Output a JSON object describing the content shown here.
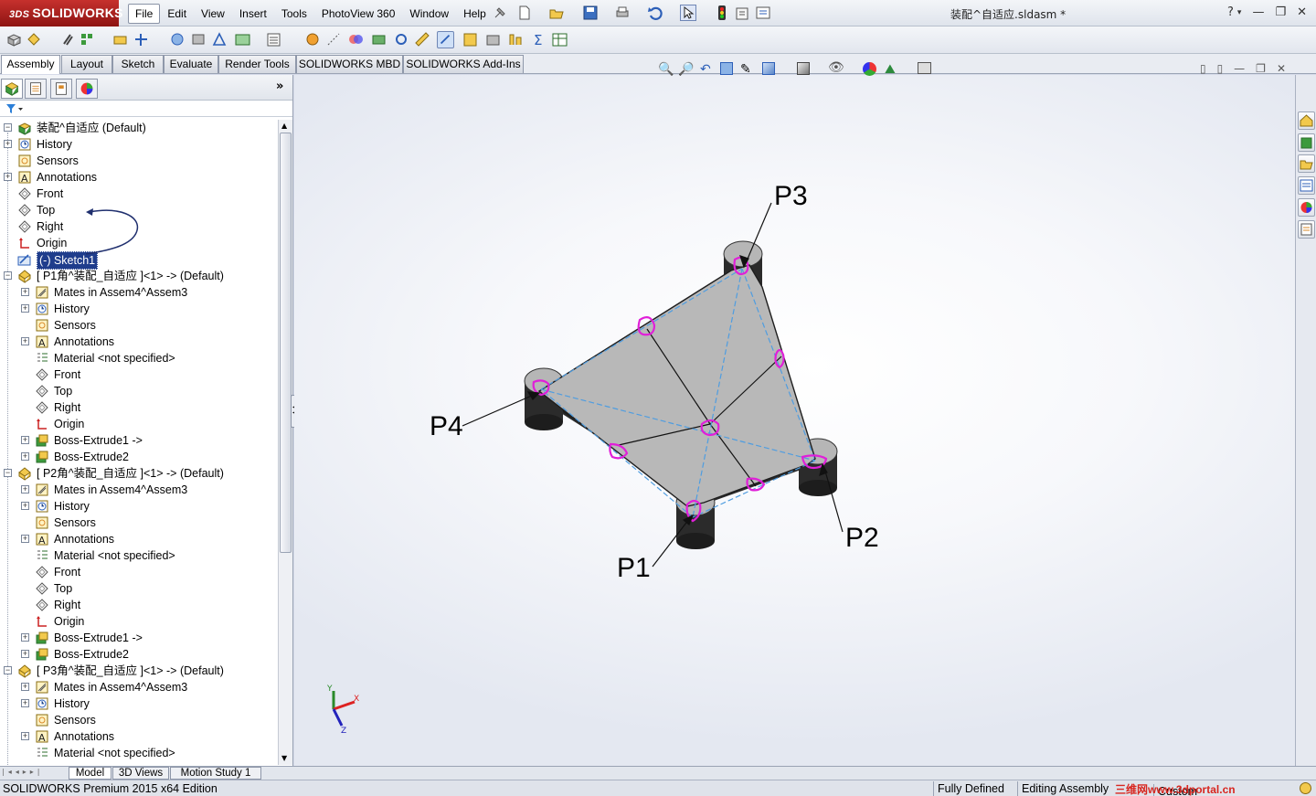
{
  "app": {
    "logo_text": "SOLIDWORKS",
    "logo_prefix": "3DS",
    "document_title": "装配^自适应.sldasm *"
  },
  "menu": [
    "File",
    "Edit",
    "View",
    "Insert",
    "Tools",
    "PhotoView 360",
    "Window",
    "Help"
  ],
  "command_tabs": [
    "Assembly",
    "Layout",
    "Sketch",
    "Evaluate",
    "Render Tools",
    "SOLIDWORKS MBD",
    "SOLIDWORKS Add-Ins"
  ],
  "active_tab": "Assembly",
  "feature_tree": [
    {
      "level": 0,
      "expander": "-",
      "icon": "assembly-icon",
      "label": "装配^自适应  (Default)"
    },
    {
      "level": 0,
      "expander": "+",
      "icon": "history-icon",
      "label": "History"
    },
    {
      "level": 0,
      "expander": "",
      "icon": "sensor-icon",
      "label": "Sensors"
    },
    {
      "level": 0,
      "expander": "+",
      "icon": "annotation-icon",
      "label": "Annotations"
    },
    {
      "level": 0,
      "expander": "",
      "icon": "plane-icon",
      "label": "Front"
    },
    {
      "level": 0,
      "expander": "",
      "icon": "plane-icon",
      "label": "Top"
    },
    {
      "level": 0,
      "expander": "",
      "icon": "plane-icon",
      "label": "Right"
    },
    {
      "level": 0,
      "expander": "",
      "icon": "origin-icon",
      "label": "Origin"
    },
    {
      "level": 0,
      "expander": "",
      "icon": "sketch-icon",
      "label": "(-) Sketch1",
      "selected": true
    },
    {
      "level": 0,
      "expander": "-",
      "icon": "part-icon",
      "label": "[ P1角^装配_自适应 ]<1> -> (Default)"
    },
    {
      "level": 1,
      "expander": "+",
      "icon": "mates-icon",
      "label": "Mates in Assem4^Assem3"
    },
    {
      "level": 1,
      "expander": "+",
      "icon": "history-icon",
      "label": "History"
    },
    {
      "level": 1,
      "expander": "",
      "icon": "sensor-icon",
      "label": "Sensors"
    },
    {
      "level": 1,
      "expander": "+",
      "icon": "annotation-icon",
      "label": "Annotations"
    },
    {
      "level": 1,
      "expander": "",
      "icon": "material-icon",
      "label": "Material <not specified>"
    },
    {
      "level": 1,
      "expander": "",
      "icon": "plane-icon",
      "label": "Front"
    },
    {
      "level": 1,
      "expander": "",
      "icon": "plane-icon",
      "label": "Top"
    },
    {
      "level": 1,
      "expander": "",
      "icon": "plane-icon",
      "label": "Right"
    },
    {
      "level": 1,
      "expander": "",
      "icon": "origin-icon",
      "label": "Origin"
    },
    {
      "level": 1,
      "expander": "+",
      "icon": "extrude-icon",
      "label": "Boss-Extrude1 ->"
    },
    {
      "level": 1,
      "expander": "+",
      "icon": "extrude-icon",
      "label": "Boss-Extrude2"
    },
    {
      "level": 0,
      "expander": "-",
      "icon": "part-icon",
      "label": "[ P2角^装配_自适应 ]<1> -> (Default)"
    },
    {
      "level": 1,
      "expander": "+",
      "icon": "mates-icon",
      "label": "Mates in Assem4^Assem3"
    },
    {
      "level": 1,
      "expander": "+",
      "icon": "history-icon",
      "label": "History"
    },
    {
      "level": 1,
      "expander": "",
      "icon": "sensor-icon",
      "label": "Sensors"
    },
    {
      "level": 1,
      "expander": "+",
      "icon": "annotation-icon",
      "label": "Annotations"
    },
    {
      "level": 1,
      "expander": "",
      "icon": "material-icon",
      "label": "Material <not specified>"
    },
    {
      "level": 1,
      "expander": "",
      "icon": "plane-icon",
      "label": "Front"
    },
    {
      "level": 1,
      "expander": "",
      "icon": "plane-icon",
      "label": "Top"
    },
    {
      "level": 1,
      "expander": "",
      "icon": "plane-icon",
      "label": "Right"
    },
    {
      "level": 1,
      "expander": "",
      "icon": "origin-icon",
      "label": "Origin"
    },
    {
      "level": 1,
      "expander": "+",
      "icon": "extrude-icon",
      "label": "Boss-Extrude1 ->"
    },
    {
      "level": 1,
      "expander": "+",
      "icon": "extrude-icon",
      "label": "Boss-Extrude2"
    },
    {
      "level": 0,
      "expander": "-",
      "icon": "part-icon",
      "label": "[ P3角^装配_自适应 ]<1> -> (Default)"
    },
    {
      "level": 1,
      "expander": "+",
      "icon": "mates-icon",
      "label": "Mates in Assem4^Assem3"
    },
    {
      "level": 1,
      "expander": "+",
      "icon": "history-icon",
      "label": "History"
    },
    {
      "level": 1,
      "expander": "",
      "icon": "sensor-icon",
      "label": "Sensors"
    },
    {
      "level": 1,
      "expander": "+",
      "icon": "annotation-icon",
      "label": "Annotations"
    },
    {
      "level": 1,
      "expander": "",
      "icon": "material-icon",
      "label": "Material <not specified>"
    }
  ],
  "viewport": {
    "callouts": {
      "p1": "P1",
      "p2": "P2",
      "p3": "P3",
      "p4": "P4"
    },
    "triad": {
      "x": "X",
      "y": "Y",
      "z": "Z"
    }
  },
  "bottom_tabs": [
    "Model",
    "3D Views",
    "Motion Study 1"
  ],
  "status": {
    "edition": "SOLIDWORKS Premium 2015 x64 Edition",
    "sketch_state": "Fully Defined",
    "mode": "Editing Assembly",
    "units": "Custom",
    "watermark": "三维网www.3dportal.cn"
  },
  "colors": {
    "brand_red": "#c6312d",
    "selection": "#1f3d8c",
    "highlight_magenta": "#e020d8",
    "sketch_blue": "#4f9de0",
    "part_gray": "#b8b8b8"
  }
}
